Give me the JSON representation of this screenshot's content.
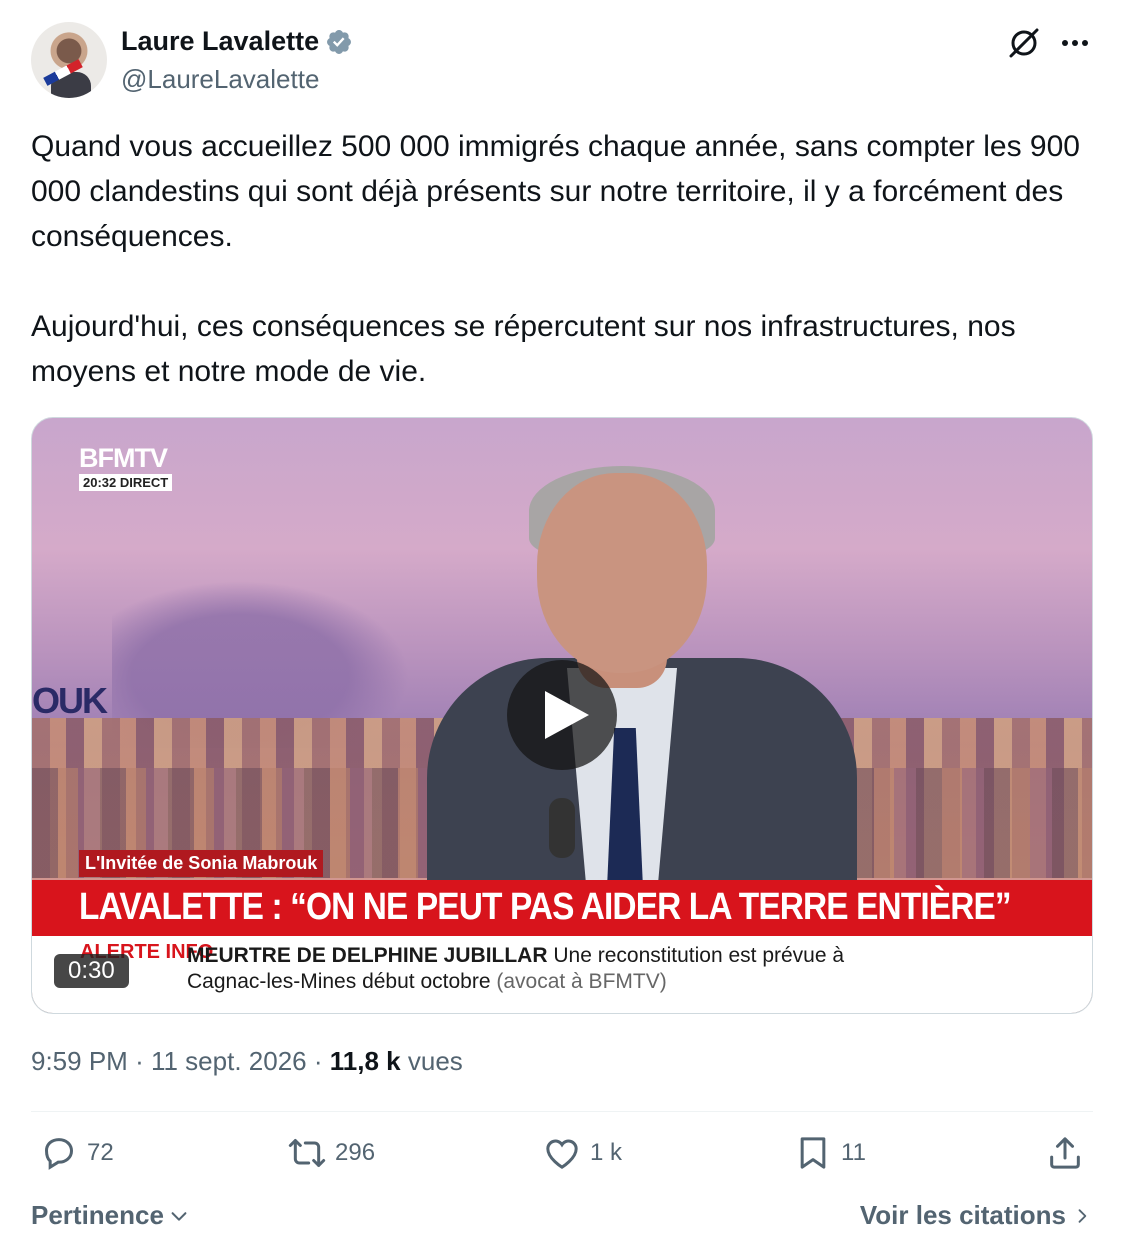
{
  "author": {
    "name": "Laure Lavalette",
    "handle": "@LaureLavalette",
    "verified_color": "#829aab"
  },
  "tweet": {
    "paragraphs": [
      "Quand vous accueillez 500 000 immigrés chaque année, sans compter les 900 000 clandestins qui sont déjà présents sur notre territoire, il y a forcément des conséquences.",
      "Aujourd'hui, ces conséquences se répercutent sur nos infrastructures, nos moyens et notre mode de vie."
    ]
  },
  "video": {
    "channel": "BFMTV",
    "time_badge": "20:32 DIRECT",
    "side_fragment": "OUK",
    "invitee_label": "L'Invitée de Sonia Mabrouk",
    "headline": "LAVALETTE : “ON NE PEUT PAS AIDER LA TERRE ENTIÈRE”",
    "alert_label": "ALERTE INFO",
    "ticker_bold": "MEURTRE DE DELPHINE JUBILLAR",
    "ticker_rest": "Une reconstitution est prévue à",
    "ticker_line2": "Cagnac-les-Mines début octobre",
    "ticker_source": "(avocat à BFMTV)",
    "duration": "0:30",
    "colors": {
      "red_band": "#d8141c"
    }
  },
  "meta": {
    "time": "9:59 PM",
    "separator": "·",
    "date": "11 sept. 2026",
    "views_count": "11,8 k",
    "views_label": "vues"
  },
  "actions": {
    "replies": "72",
    "reposts": "296",
    "likes": "1 k",
    "bookmarks": "11"
  },
  "footer": {
    "sort_label": "Pertinence",
    "quotes_label": "Voir les citations"
  },
  "icons": [
    "grok-icon",
    "more-icon",
    "verified-icon",
    "play-icon",
    "reply-icon",
    "repost-icon",
    "like-icon",
    "bookmark-icon",
    "share-icon",
    "chevron-down-icon",
    "chevron-right-icon"
  ]
}
